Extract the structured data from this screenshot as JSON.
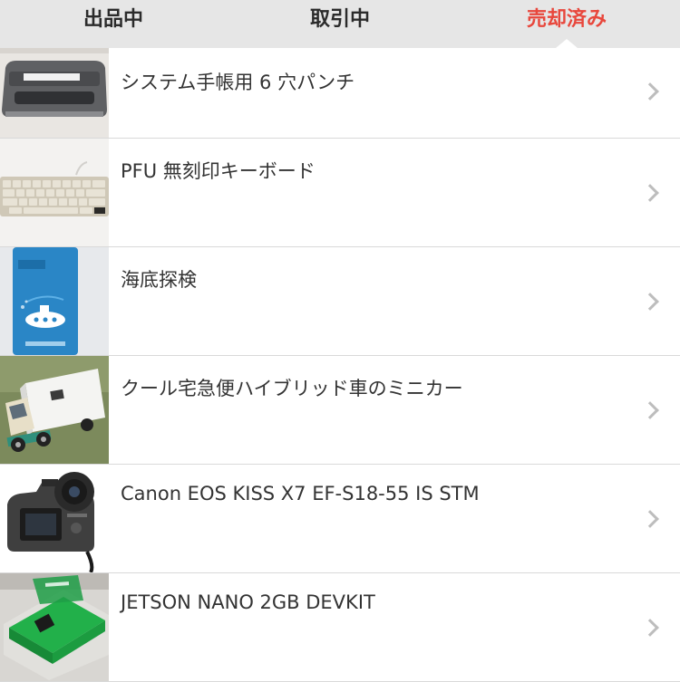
{
  "tabs": [
    {
      "label": "出品中",
      "active": false
    },
    {
      "label": "取引中",
      "active": false
    },
    {
      "label": "売却済み",
      "active": true
    }
  ],
  "accent_color": "#e8473c",
  "items": [
    {
      "title": "システム手帳用 6 穴パンチ",
      "thumbnail": "hole-punch-photo"
    },
    {
      "title": "PFU 無刻印キーボード",
      "thumbnail": "keyboard-photo"
    },
    {
      "title": "海底探検",
      "thumbnail": "submarine-card-game-photo"
    },
    {
      "title": "クール宅急便ハイブリッド車のミニカー",
      "thumbnail": "delivery-truck-minicar-photo"
    },
    {
      "title": "Canon EOS KISS X7 EF-S18-55 IS STM",
      "thumbnail": "dslr-camera-photo"
    },
    {
      "title": "JETSON NANO 2GB DEVKIT",
      "thumbnail": "dev-board-photo"
    }
  ]
}
